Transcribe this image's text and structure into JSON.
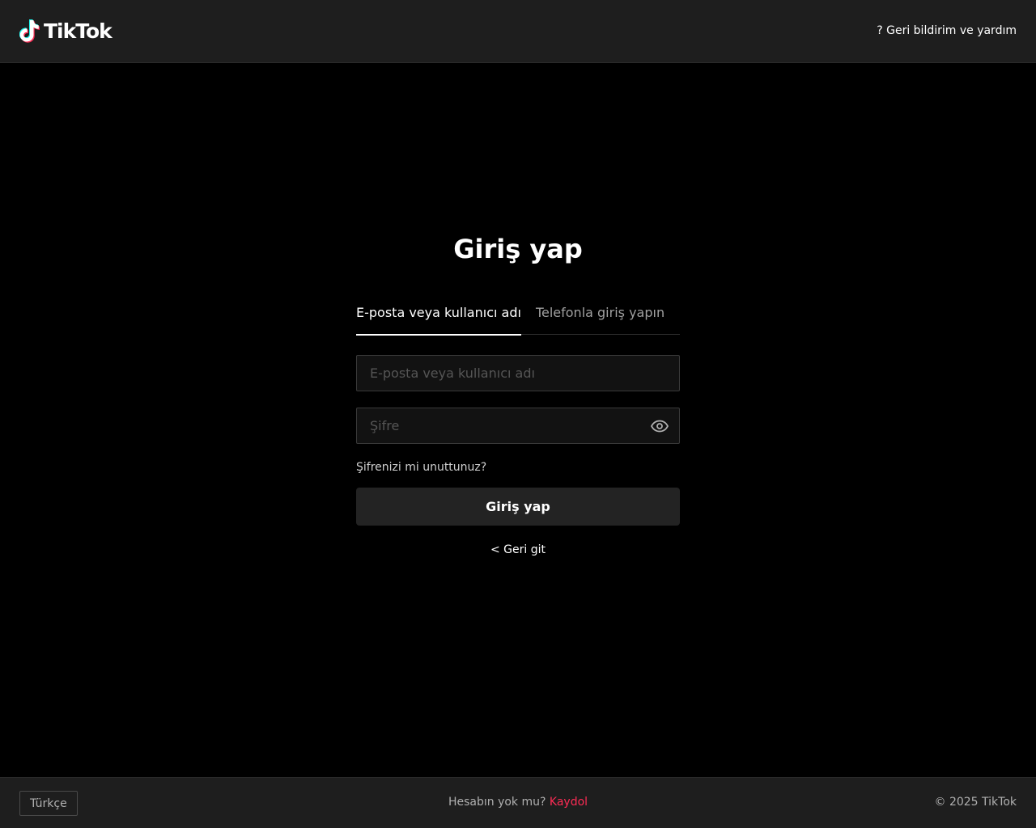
{
  "header": {
    "logo_text": "TikTok",
    "help_link": "? Geri bildirim ve yardım"
  },
  "login": {
    "title": "Giriş yap",
    "tabs": [
      {
        "label": "E-posta veya kullanıcı adı",
        "active": true
      },
      {
        "label": "Telefonla giriş yapın",
        "active": false
      }
    ],
    "username_placeholder": "E-posta veya kullanıcı adı",
    "username_value": "",
    "password_placeholder": "Şifre",
    "password_value": "",
    "forgot_password": "Şifrenizi mi unuttunuz?",
    "submit_label": "Giriş yap",
    "back_label": "< Geri git"
  },
  "footer": {
    "language": "Türkçe",
    "no_account": "Hesabın yok mu?",
    "signup": "Kaydol",
    "copyright": "© 2025 TikTok"
  },
  "colors": {
    "accent": "#fe2c55",
    "logo_cyan": "#25f4ee",
    "background": "#000000",
    "bar": "#1e1e1e"
  },
  "icons": {
    "logo": "tiktok-note-icon",
    "password_toggle": "eye-icon"
  }
}
